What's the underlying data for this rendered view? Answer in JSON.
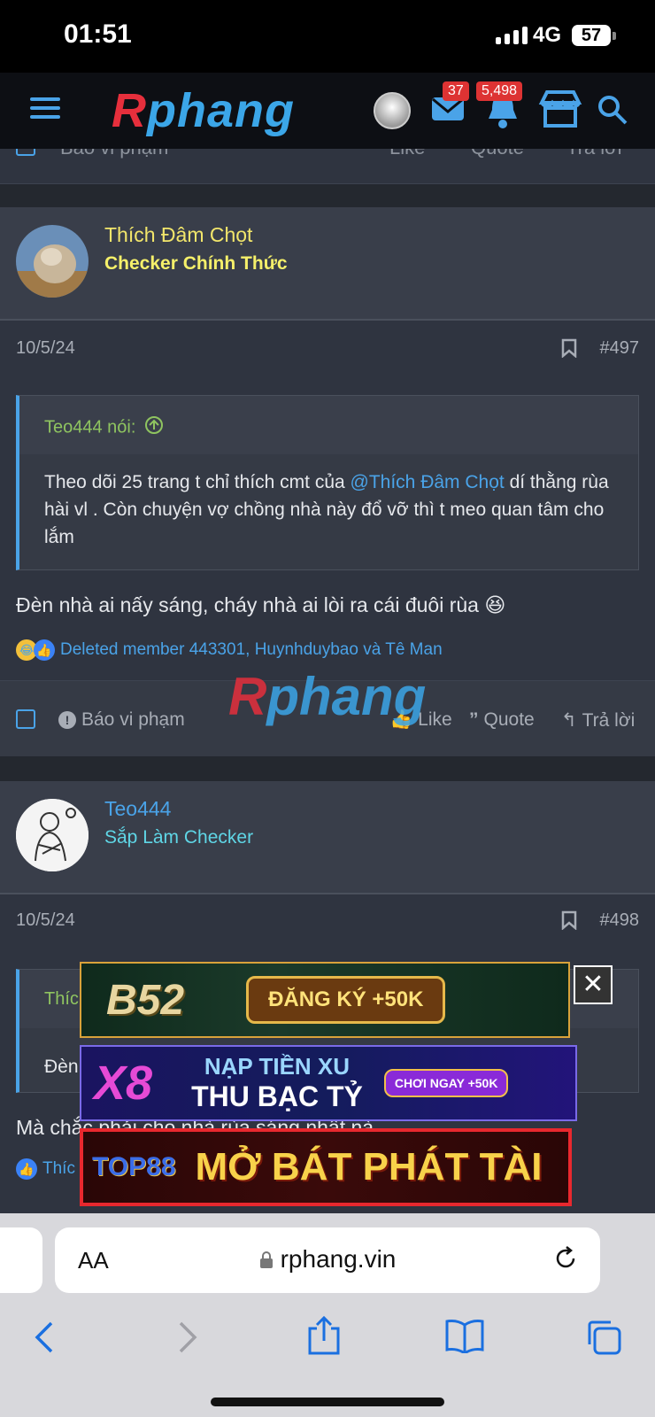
{
  "status": {
    "time": "01:51",
    "network": "4G",
    "battery": "57"
  },
  "header": {
    "logo_r": "R",
    "logo_rest": "phang",
    "messages_badge": "37",
    "alerts_badge": "5,498"
  },
  "top_actions": {
    "report": "Báo vi phạm",
    "like": "Like",
    "quote": "Quote",
    "reply": "Trả lời"
  },
  "posts": [
    {
      "username": "Thích Đâm Chọt",
      "user_title": "Checker Chính Thức",
      "date": "10/5/24",
      "post_num": "#497",
      "quote_author": "Teo444 nói:",
      "quote_text_pre": "Theo dõi 25 trang t chỉ thích cmt của ",
      "quote_mention": "@Thích Đâm Chọt",
      "quote_text_post": " dí thằng rùa hài vl . Còn chuyện vợ chồng nhà này đổ vỡ thì t meo quan tâm cho lắm",
      "message": "Đèn nhà ai nấy sáng, cháy nhà ai lòi ra cái đuôi rùa 😆",
      "reactions_text": "Deleted member 443301, Huynhduybao và Tê Man",
      "actions": {
        "report": "Báo vi phạm",
        "like": "Like",
        "quote": "Quote",
        "reply": "Trả lời"
      }
    },
    {
      "username": "Teo444",
      "user_title": "Sắp Làm Checker",
      "date": "10/5/24",
      "post_num": "#498",
      "quote_author_partial": "Thíc",
      "quote_text_partial": "Đèn",
      "message_partial": "Mà chắc phải cho nhà rùa sáng nhất nà",
      "reactions_partial": "Thíc"
    }
  ],
  "watermark": {
    "r": "R",
    "rest": "phang"
  },
  "ads": [
    {
      "brand": "B52",
      "text": "ĐĂNG KÝ +50K",
      "color_bg": "#1b3a2a"
    },
    {
      "brand": "X8",
      "text_line1": "NẠP TIỀN XU",
      "text_line2": "THU BẠC TỶ",
      "cta": "CHƠI NGAY +50K",
      "color_bg": "#141c5c"
    },
    {
      "brand": "TOP88",
      "text": "MỞ BÁT PHÁT TÀI",
      "color_bg": "#3a0a0a"
    }
  ],
  "ad_close": "✕",
  "safari": {
    "aa": "AA",
    "url": "rphang.vin"
  }
}
